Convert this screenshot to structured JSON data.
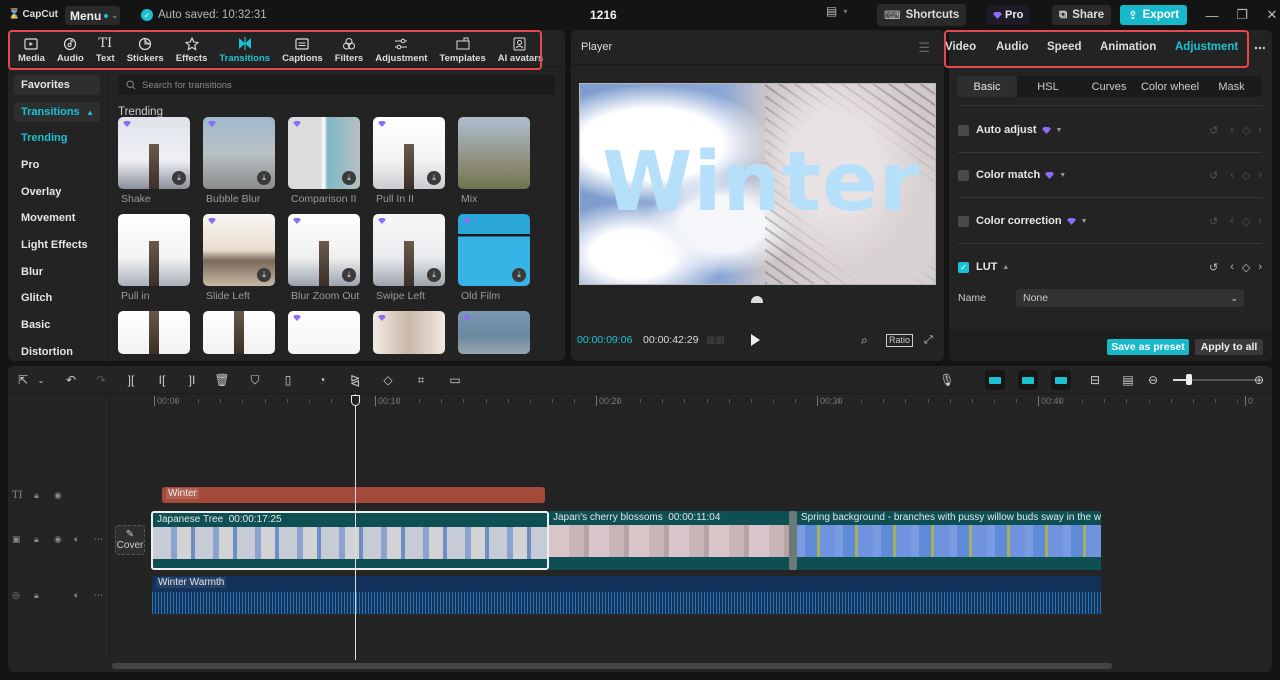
{
  "titlebar": {
    "app_name": "CapCut",
    "menu_label": "Menu",
    "autosave": "Auto saved: 10:32:31",
    "project_title": "1216",
    "shortcuts_label": "Shortcuts",
    "pro_label": "Pro",
    "share_label": "Share",
    "export_label": "Export"
  },
  "toolbar": {
    "tabs": [
      {
        "label": "Media",
        "icon": "media-icon"
      },
      {
        "label": "Audio",
        "icon": "audio-icon"
      },
      {
        "label": "Text",
        "icon": "text-icon"
      },
      {
        "label": "Stickers",
        "icon": "stickers-icon"
      },
      {
        "label": "Effects",
        "icon": "effects-icon"
      },
      {
        "label": "Transitions",
        "icon": "transitions-icon",
        "active": true
      },
      {
        "label": "Captions",
        "icon": "captions-icon"
      },
      {
        "label": "Filters",
        "icon": "filters-icon"
      },
      {
        "label": "Adjustment",
        "icon": "adjustment-icon"
      },
      {
        "label": "Templates",
        "icon": "templates-icon"
      },
      {
        "label": "AI avatars",
        "icon": "ai-avatars-icon"
      }
    ]
  },
  "sidebar": {
    "items": [
      {
        "label": "Favorites"
      },
      {
        "label": "Transitions",
        "expanded": true
      },
      {
        "label": "Trending",
        "active": true
      },
      {
        "label": "Pro"
      },
      {
        "label": "Overlay"
      },
      {
        "label": "Movement"
      },
      {
        "label": "Light Effects"
      },
      {
        "label": "Blur"
      },
      {
        "label": "Glitch"
      },
      {
        "label": "Basic"
      },
      {
        "label": "Distortion"
      }
    ]
  },
  "library": {
    "search_placeholder": "Search for transitions",
    "section_title": "Trending",
    "items": [
      {
        "name": "Shake",
        "pro": true,
        "download": true
      },
      {
        "name": "Bubble Blur",
        "pro": true,
        "download": true
      },
      {
        "name": "Comparison II",
        "pro": true,
        "download": true
      },
      {
        "name": "Pull In II",
        "pro": true,
        "download": true
      },
      {
        "name": "Mix",
        "pro": false,
        "download": false
      },
      {
        "name": "Pull in",
        "pro": false,
        "download": false
      },
      {
        "name": "Slide Left",
        "pro": true,
        "download": true
      },
      {
        "name": "Blur Zoom Out",
        "pro": true,
        "download": true
      },
      {
        "name": "Swipe Left",
        "pro": true,
        "download": true
      },
      {
        "name": "Old Film",
        "pro": true,
        "download": true
      },
      {
        "name": "",
        "pro": false
      },
      {
        "name": "",
        "pro": false
      },
      {
        "name": "",
        "pro": true
      },
      {
        "name": "",
        "pro": true
      },
      {
        "name": "",
        "pro": true
      }
    ]
  },
  "player": {
    "title": "Player",
    "overlay_text": "Winter",
    "current_time": "00:00:09:06",
    "duration": "00:00:42:29",
    "ratio_label": "Ratio"
  },
  "inspector": {
    "tabs": [
      {
        "label": "Video"
      },
      {
        "label": "Audio"
      },
      {
        "label": "Speed"
      },
      {
        "label": "Animation"
      },
      {
        "label": "Adjustment",
        "active": true
      }
    ],
    "sub_tabs": [
      {
        "label": "Basic",
        "active": true
      },
      {
        "label": "HSL"
      },
      {
        "label": "Curves"
      },
      {
        "label": "Color wheel"
      },
      {
        "label": "Mask"
      }
    ],
    "sections": [
      {
        "label": "Auto adjust",
        "checked": false,
        "pro": true
      },
      {
        "label": "Color match",
        "checked": false,
        "pro": true
      },
      {
        "label": "Color correction",
        "checked": false,
        "pro": true
      },
      {
        "label": "LUT",
        "checked": true,
        "pro": false
      }
    ],
    "lut_name_label": "Name",
    "lut_name_value": "None",
    "save_preset_label": "Save as preset",
    "apply_all_label": "Apply to all"
  },
  "timeline": {
    "ruler_labels": [
      "00:00",
      "00:10",
      "00:20",
      "00:30",
      "00:40",
      "0"
    ],
    "cover_label": "Cover",
    "text_clip": "Winter",
    "video_clips": [
      {
        "name": "Japanese Tree",
        "duration": "00:00:17:25"
      },
      {
        "name": "Japan's cherry blossoms",
        "duration": "00:00:11:04"
      },
      {
        "name": "Spring background - branches with pussy willow buds sway in the w",
        "duration": ""
      }
    ],
    "audio_clip": "Winter Warmth",
    "zoom_level": 0.2
  },
  "colors": {
    "accent": "#1bc3d2",
    "highlight_box": "#e5484d",
    "pro_gem": "#8b6cf6",
    "text_clip": "#a54a3a",
    "video_track": "#0d4f52",
    "audio_track": "#12325b"
  }
}
